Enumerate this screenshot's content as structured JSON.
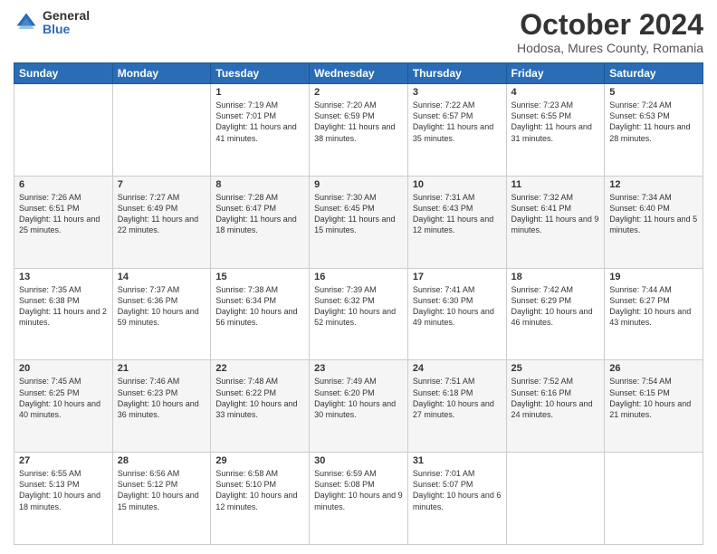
{
  "header": {
    "logo_general": "General",
    "logo_blue": "Blue",
    "month_title": "October 2024",
    "location": "Hodosa, Mures County, Romania"
  },
  "days_of_week": [
    "Sunday",
    "Monday",
    "Tuesday",
    "Wednesday",
    "Thursday",
    "Friday",
    "Saturday"
  ],
  "weeks": [
    [
      {
        "day": "",
        "sunrise": "",
        "sunset": "",
        "daylight": ""
      },
      {
        "day": "",
        "sunrise": "",
        "sunset": "",
        "daylight": ""
      },
      {
        "day": "1",
        "sunrise": "Sunrise: 7:19 AM",
        "sunset": "Sunset: 7:01 PM",
        "daylight": "Daylight: 11 hours and 41 minutes."
      },
      {
        "day": "2",
        "sunrise": "Sunrise: 7:20 AM",
        "sunset": "Sunset: 6:59 PM",
        "daylight": "Daylight: 11 hours and 38 minutes."
      },
      {
        "day": "3",
        "sunrise": "Sunrise: 7:22 AM",
        "sunset": "Sunset: 6:57 PM",
        "daylight": "Daylight: 11 hours and 35 minutes."
      },
      {
        "day": "4",
        "sunrise": "Sunrise: 7:23 AM",
        "sunset": "Sunset: 6:55 PM",
        "daylight": "Daylight: 11 hours and 31 minutes."
      },
      {
        "day": "5",
        "sunrise": "Sunrise: 7:24 AM",
        "sunset": "Sunset: 6:53 PM",
        "daylight": "Daylight: 11 hours and 28 minutes."
      }
    ],
    [
      {
        "day": "6",
        "sunrise": "Sunrise: 7:26 AM",
        "sunset": "Sunset: 6:51 PM",
        "daylight": "Daylight: 11 hours and 25 minutes."
      },
      {
        "day": "7",
        "sunrise": "Sunrise: 7:27 AM",
        "sunset": "Sunset: 6:49 PM",
        "daylight": "Daylight: 11 hours and 22 minutes."
      },
      {
        "day": "8",
        "sunrise": "Sunrise: 7:28 AM",
        "sunset": "Sunset: 6:47 PM",
        "daylight": "Daylight: 11 hours and 18 minutes."
      },
      {
        "day": "9",
        "sunrise": "Sunrise: 7:30 AM",
        "sunset": "Sunset: 6:45 PM",
        "daylight": "Daylight: 11 hours and 15 minutes."
      },
      {
        "day": "10",
        "sunrise": "Sunrise: 7:31 AM",
        "sunset": "Sunset: 6:43 PM",
        "daylight": "Daylight: 11 hours and 12 minutes."
      },
      {
        "day": "11",
        "sunrise": "Sunrise: 7:32 AM",
        "sunset": "Sunset: 6:41 PM",
        "daylight": "Daylight: 11 hours and 9 minutes."
      },
      {
        "day": "12",
        "sunrise": "Sunrise: 7:34 AM",
        "sunset": "Sunset: 6:40 PM",
        "daylight": "Daylight: 11 hours and 5 minutes."
      }
    ],
    [
      {
        "day": "13",
        "sunrise": "Sunrise: 7:35 AM",
        "sunset": "Sunset: 6:38 PM",
        "daylight": "Daylight: 11 hours and 2 minutes."
      },
      {
        "day": "14",
        "sunrise": "Sunrise: 7:37 AM",
        "sunset": "Sunset: 6:36 PM",
        "daylight": "Daylight: 10 hours and 59 minutes."
      },
      {
        "day": "15",
        "sunrise": "Sunrise: 7:38 AM",
        "sunset": "Sunset: 6:34 PM",
        "daylight": "Daylight: 10 hours and 56 minutes."
      },
      {
        "day": "16",
        "sunrise": "Sunrise: 7:39 AM",
        "sunset": "Sunset: 6:32 PM",
        "daylight": "Daylight: 10 hours and 52 minutes."
      },
      {
        "day": "17",
        "sunrise": "Sunrise: 7:41 AM",
        "sunset": "Sunset: 6:30 PM",
        "daylight": "Daylight: 10 hours and 49 minutes."
      },
      {
        "day": "18",
        "sunrise": "Sunrise: 7:42 AM",
        "sunset": "Sunset: 6:29 PM",
        "daylight": "Daylight: 10 hours and 46 minutes."
      },
      {
        "day": "19",
        "sunrise": "Sunrise: 7:44 AM",
        "sunset": "Sunset: 6:27 PM",
        "daylight": "Daylight: 10 hours and 43 minutes."
      }
    ],
    [
      {
        "day": "20",
        "sunrise": "Sunrise: 7:45 AM",
        "sunset": "Sunset: 6:25 PM",
        "daylight": "Daylight: 10 hours and 40 minutes."
      },
      {
        "day": "21",
        "sunrise": "Sunrise: 7:46 AM",
        "sunset": "Sunset: 6:23 PM",
        "daylight": "Daylight: 10 hours and 36 minutes."
      },
      {
        "day": "22",
        "sunrise": "Sunrise: 7:48 AM",
        "sunset": "Sunset: 6:22 PM",
        "daylight": "Daylight: 10 hours and 33 minutes."
      },
      {
        "day": "23",
        "sunrise": "Sunrise: 7:49 AM",
        "sunset": "Sunset: 6:20 PM",
        "daylight": "Daylight: 10 hours and 30 minutes."
      },
      {
        "day": "24",
        "sunrise": "Sunrise: 7:51 AM",
        "sunset": "Sunset: 6:18 PM",
        "daylight": "Daylight: 10 hours and 27 minutes."
      },
      {
        "day": "25",
        "sunrise": "Sunrise: 7:52 AM",
        "sunset": "Sunset: 6:16 PM",
        "daylight": "Daylight: 10 hours and 24 minutes."
      },
      {
        "day": "26",
        "sunrise": "Sunrise: 7:54 AM",
        "sunset": "Sunset: 6:15 PM",
        "daylight": "Daylight: 10 hours and 21 minutes."
      }
    ],
    [
      {
        "day": "27",
        "sunrise": "Sunrise: 6:55 AM",
        "sunset": "Sunset: 5:13 PM",
        "daylight": "Daylight: 10 hours and 18 minutes."
      },
      {
        "day": "28",
        "sunrise": "Sunrise: 6:56 AM",
        "sunset": "Sunset: 5:12 PM",
        "daylight": "Daylight: 10 hours and 15 minutes."
      },
      {
        "day": "29",
        "sunrise": "Sunrise: 6:58 AM",
        "sunset": "Sunset: 5:10 PM",
        "daylight": "Daylight: 10 hours and 12 minutes."
      },
      {
        "day": "30",
        "sunrise": "Sunrise: 6:59 AM",
        "sunset": "Sunset: 5:08 PM",
        "daylight": "Daylight: 10 hours and 9 minutes."
      },
      {
        "day": "31",
        "sunrise": "Sunrise: 7:01 AM",
        "sunset": "Sunset: 5:07 PM",
        "daylight": "Daylight: 10 hours and 6 minutes."
      },
      {
        "day": "",
        "sunrise": "",
        "sunset": "",
        "daylight": ""
      },
      {
        "day": "",
        "sunrise": "",
        "sunset": "",
        "daylight": ""
      }
    ]
  ]
}
